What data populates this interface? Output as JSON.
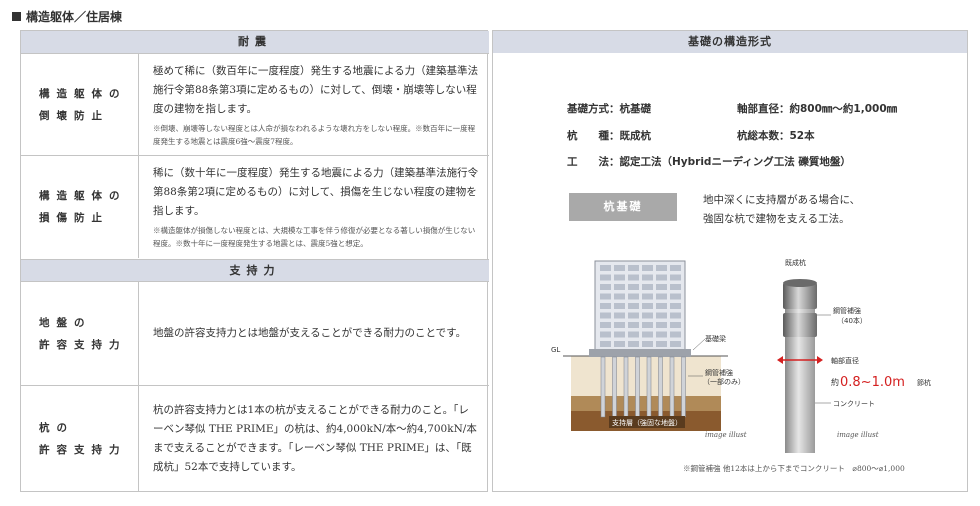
{
  "page_title": "構造躯体／住居棟",
  "left": {
    "header_taishin": "耐震",
    "header_shijiryoku": "支持力",
    "rows": [
      {
        "label_line1": "構造躯体の",
        "label_line2": "倒壊防止",
        "text": "極めて稀に（数百年に一度程度）発生する地震による力（建築基準法施行令第88条第3項に定めるもの）に対して、倒壊・崩壊等しない程度の建物を指します。",
        "note": "※倒壊、崩壊等しない程度とは人命が損なわれるような壊れ方をしない程度。※数百年に一度程度発生する地震とは震度6強〜震度7程度。"
      },
      {
        "label_line1": "構造躯体の",
        "label_line2": "損傷防止",
        "text": "稀に（数十年に一度程度）発生する地震による力（建築基準法施行令第88条第2項に定めるもの）に対して、損傷を生じない程度の建物を指します。",
        "note": "※構造躯体が損傷しない程度とは、大規模な工事を伴う修復が必要となる著しい損傷が生じない程度。※数十年に一度程度発生する地震とは、震度5強と想定。"
      },
      {
        "label_line1": "地盤の",
        "label_line2": "許容支持力",
        "text": "地盤の許容支持力とは地盤が支えることができる耐力のことです。"
      },
      {
        "label_line1": "杭の",
        "label_line2": "許容支持力",
        "text": "杭の許容支持力とは1本の杭が支えることができる耐力のこと。「レーベン琴似 THE PRIME」の杭は、約4,000kN/本〜約4,700kN/本まで支えることができます。「レーベン琴似 THE PRIME」は、「既成杭」52本で支持しています。"
      }
    ]
  },
  "right": {
    "header": "基礎の構造形式",
    "spec_kiso": "基礎方式：杭基礎",
    "spec_kui": "杭　　種：既成杭",
    "spec_koho": "工　　法：認定工法（Hybridニーディング工法 礫質地盤）",
    "spec_jikubu": "軸部直径：約800㎜〜約1,000㎜",
    "spec_kuisu": "杭総本数：52本",
    "badge": "杭基礎",
    "desc_line1": "地中深くに支持層がある場合に、",
    "desc_line2": "強固な杭で建物を支える工法。",
    "diagram": {
      "gl": "GL",
      "kisobari": "基礎梁",
      "kokan1": "鋼管補強",
      "kokan2": "（一部のみ）",
      "shijiso": "支持層（強固な地盤）",
      "kiseikui": "既成杭",
      "kokan_pile1": "鋼管補強",
      "kokan_pile2": "（40本）",
      "jikubu": "軸部直径",
      "yaku": "約",
      "range": "0.8~1.0m",
      "sekko": "節杭",
      "concrete": "コンクリート",
      "illust1": "image illust",
      "illust2": "image illust",
      "red": "#d42020"
    },
    "footnote": "※鋼管補強 他12本は上から下までコンクリート　⌀800〜⌀1,000"
  }
}
